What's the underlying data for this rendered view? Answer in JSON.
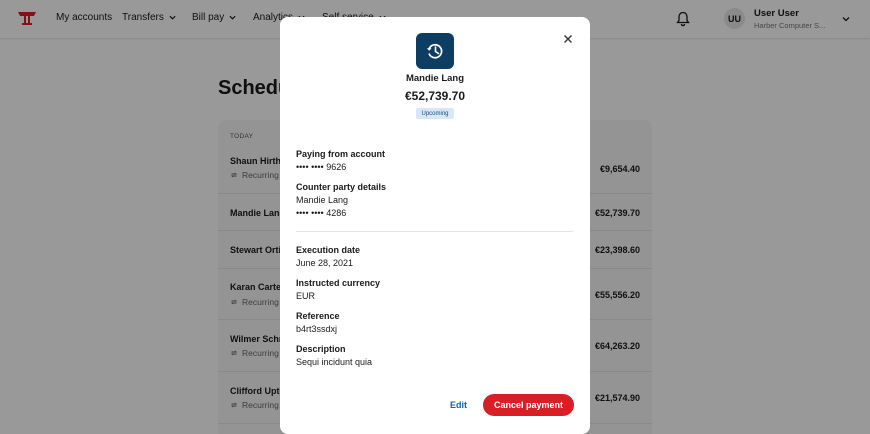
{
  "nav": {
    "items": [
      {
        "label": "My accounts",
        "dropdown": false
      },
      {
        "label": "Transfers",
        "dropdown": true
      },
      {
        "label": "Bill pay",
        "dropdown": true
      },
      {
        "label": "Analytics",
        "dropdown": true
      },
      {
        "label": "Self service",
        "dropdown": true
      }
    ],
    "user": {
      "initials": "UU",
      "name": "User User",
      "org": "Harber Computer S..."
    }
  },
  "page": {
    "title": "Scheduled payments",
    "section_label": "TODAY",
    "rows": [
      {
        "name": "Shaun Hirthe",
        "sub": "Recurring",
        "amount": "€9,654.40",
        "recurring": true
      },
      {
        "name": "Mandie Lang",
        "sub": "",
        "amount": "€52,739.70",
        "recurring": false
      },
      {
        "name": "Stewart Ortiz",
        "sub": "",
        "amount": "€23,398.60",
        "recurring": false
      },
      {
        "name": "Karan Carter",
        "sub": "Recurring",
        "amount": "€55,556.20",
        "recurring": true
      },
      {
        "name": "Wilmer Schmidt",
        "sub": "Recurring",
        "amount": "€64,263.20",
        "recurring": true
      },
      {
        "name": "Clifford Upton",
        "sub": "Recurring",
        "amount": "€21,574.90",
        "recurring": true
      }
    ]
  },
  "modal": {
    "name": "Mandie Lang",
    "amount": "€52,739.70",
    "status": "Upcoming",
    "fields": {
      "paying_from_label": "Paying from account",
      "paying_from_value": "•••• •••• 9626",
      "counterparty_label": "Counter party details",
      "counterparty_name": "Mandie Lang",
      "counterparty_account": "•••• •••• 4286",
      "execution_label": "Execution date",
      "execution_value": "June 28, 2021",
      "currency_label": "Instructed currency",
      "currency_value": "EUR",
      "reference_label": "Reference",
      "reference_value": "b4rt3ssdxj",
      "description_label": "Description",
      "description_value": "Sequi incidunt quia"
    },
    "edit_label": "Edit",
    "cancel_label": "Cancel payment"
  },
  "colors": {
    "brand_red": "#d81f26",
    "icon_navy": "#0d3d63",
    "badge_bg": "#d6e8f7",
    "link_blue": "#1463a8"
  }
}
